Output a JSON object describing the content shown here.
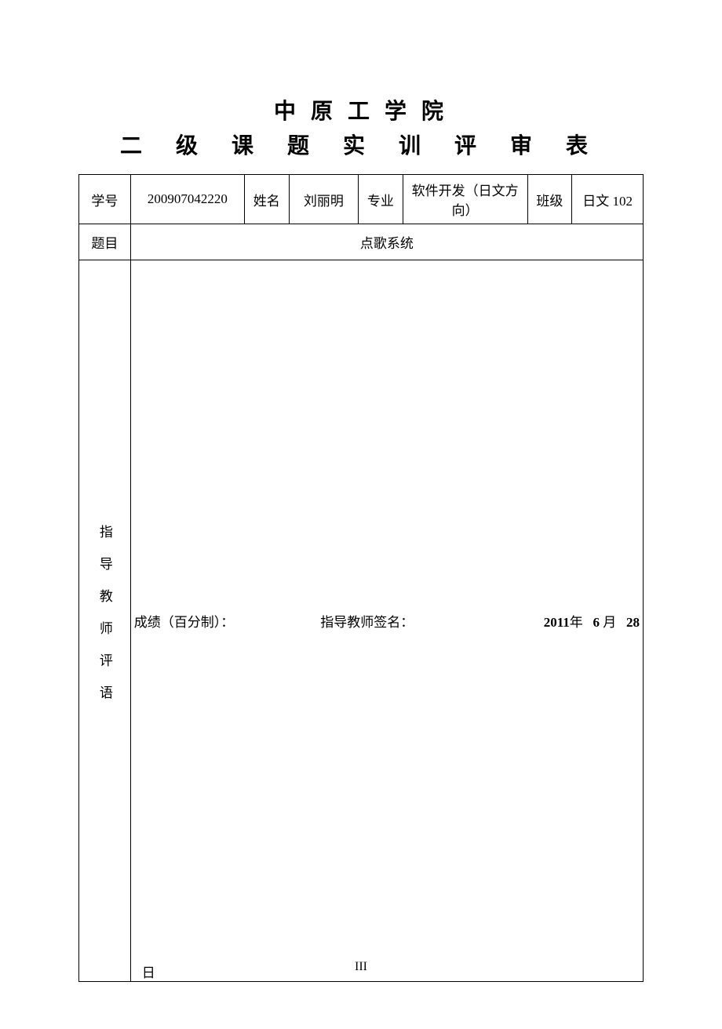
{
  "header": {
    "institution": "中 原 工 学 院",
    "form_title": "二 级 课 题 实 训 评 审 表"
  },
  "labels": {
    "student_id": "学号",
    "name": "姓名",
    "major": "专业",
    "class": "班级",
    "topic": "题目",
    "advisor_comments": "指导教师评语"
  },
  "student": {
    "id": "200907042220",
    "name": "刘丽明",
    "major": "软件开发（日文方向）",
    "class": "日文 102"
  },
  "topic": "点歌系统",
  "footer": {
    "score_label": "成绩（百分制）：",
    "signature_label": "指导教师签名：",
    "date_year": "2011",
    "year_char": "年",
    "date_month": "6",
    "month_char": "月",
    "date_day": "28",
    "day_char": "日"
  },
  "page_number": "III"
}
